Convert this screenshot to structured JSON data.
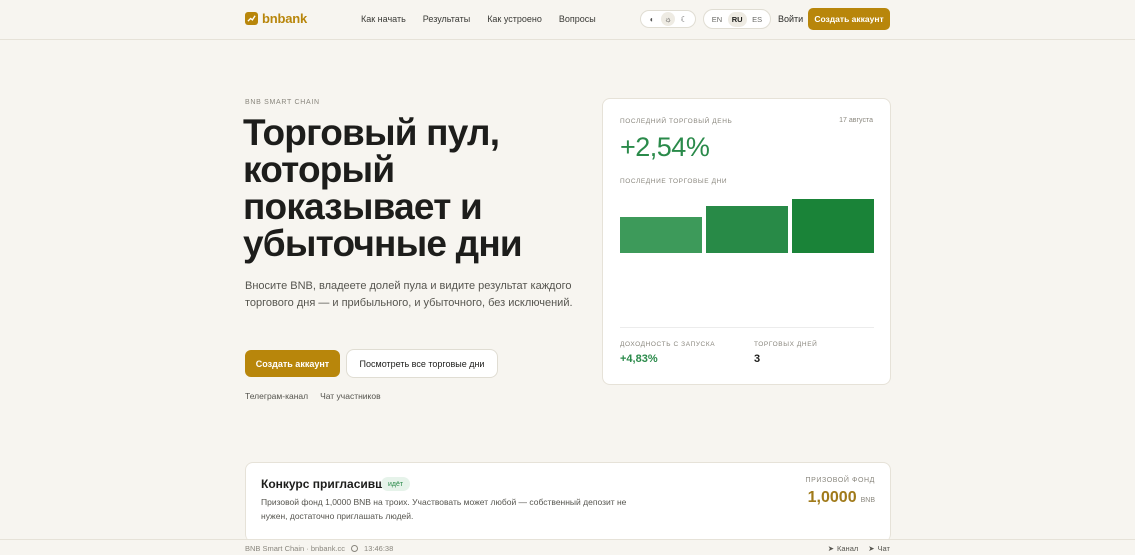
{
  "header": {
    "logo_text": "bnbank",
    "nav": [
      "Как начать",
      "Результаты",
      "Как устроено",
      "Вопросы"
    ],
    "theme_icons": [
      "half-circle-icon",
      "sun-icon",
      "moon-icon"
    ],
    "theme_active": "sun",
    "languages": [
      "EN",
      "RU",
      "ES"
    ],
    "language_active": "RU",
    "login_label": "Войти",
    "create_account_label": "Создать аккаунт"
  },
  "hero": {
    "eyebrow": "BNB SMART CHAIN",
    "title_lines": [
      "Торговый пул,",
      "который",
      "показывает и",
      "убыточные дни"
    ],
    "description": "Вносите BNB, владеете долей пула и видите результат каждого торгового дня — и прибыльного, и убыточного, без исключений.",
    "primary_button": "Создать аккаунт",
    "secondary_button": "Посмотреть все торговые дни",
    "links": [
      "Телеграм-канал",
      "Чат участников"
    ]
  },
  "card": {
    "label": "ПОСЛЕДНИЙ ТОРГОВЫЙ ДЕНЬ",
    "date": "17 августа",
    "percent": "+2,54%",
    "sub_label": "ПОСЛЕДНИЕ ТОРГОВЫЕ ДНИ",
    "bars": [
      {
        "value": 0.67,
        "color": "#3d9a5a"
      },
      {
        "value": 0.87,
        "color": "#288a47"
      },
      {
        "value": 1.0,
        "color": "#1a8338"
      }
    ],
    "stats": [
      {
        "label": "ДОХОДНОСТЬ С ЗАПУСКА",
        "value": "+4,83%",
        "color": "#2a8a4a"
      },
      {
        "label": "ТОРГОВЫХ ДНЕЙ",
        "value": "3",
        "color": "#1d1d1b"
      }
    ]
  },
  "contest": {
    "title": "Конкурс пригласивших",
    "badge": "идёт",
    "description": "Призовой фонд 1,0000 BNB на троих. Участвовать может любой — собственный депозит не нужен, достаточно приглашать людей.",
    "prize_label": "ПРИЗОВОЙ ФОНД",
    "prize_value": "1,0000",
    "prize_unit": "BNB"
  },
  "footer": {
    "site": "BNB Smart Chain · bnbank.cc",
    "time": "13:46:38",
    "links": [
      "Канал",
      "Чат"
    ]
  },
  "colors": {
    "accent": "#b8860b",
    "positive": "#2a8a4a",
    "background": "#f7f5f0"
  }
}
